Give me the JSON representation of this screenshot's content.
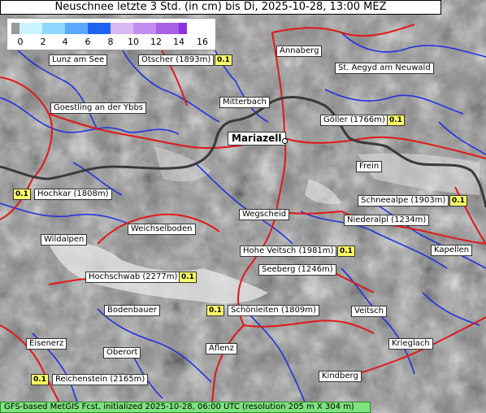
{
  "title": "Neuschnee letzte 3 Std. (in cm) bis Di, 2025-10-28, 13:00 MEZ",
  "legend": {
    "ticks": [
      "0",
      "2",
      "4",
      "6",
      "8",
      "10",
      "12",
      "14",
      "16"
    ],
    "colors": [
      "#9a9a9a",
      "#c8f4ff",
      "#8fd8ff",
      "#5aa8ff",
      "#1e64f0",
      "#d7b8f0",
      "#c48ef0",
      "#a860e8",
      "#8c32e0"
    ]
  },
  "places": {
    "lunz": "Lunz am See",
    "oetscher": "Ötscher (1893m)",
    "annaberg": "Annaberg",
    "aegyd": "St. Aegyd am Neuwald",
    "goestling": "Goestling an der Ybbs",
    "mitterbach": "Mitterbach",
    "mariazell": "Mariazell",
    "goeller": "Göller (1766m)",
    "frein": "Frein",
    "hochkar": "Hochkar (1808m)",
    "schneealpe": "Schneealpe (1903m)",
    "wegscheid": "Wegscheid",
    "niederalpl": "Niederalpl (1234m)",
    "weichselboden": "Weichselboden",
    "wildalpen": "Wildalpen",
    "veitsch_hohe": "Hohe Veitsch (1981m)",
    "kapellen": "Kapellen",
    "seeberg": "Seeberg (1246m)",
    "hochschwab": "Hochschwab (2277m)",
    "bodenbauer": "Bodenbauer",
    "schoenleiten": "Schönleiten (1809m)",
    "veitsch": "Veitsch",
    "eisenerz": "Eisenerz",
    "oberort": "Oberort",
    "aflenz": "Aflenz",
    "krieglach": "Krieglach",
    "reichenstein": "Reichenstein (2165m)",
    "kindberg": "Kindberg"
  },
  "values": {
    "oetscher": "0.1",
    "goeller": "0.1",
    "hochkar": "0.1",
    "schneealpe": "0.1",
    "veitsch_hohe": "0.1",
    "hochschwab": "0.1",
    "schoenleiten": "0.1",
    "reichenstein": "0.1"
  },
  "footer": "GFS-based MetGIS Fcst, initialized 2025-10-28, 06:00 UTC  (resolution 205 m X 304 m)"
}
